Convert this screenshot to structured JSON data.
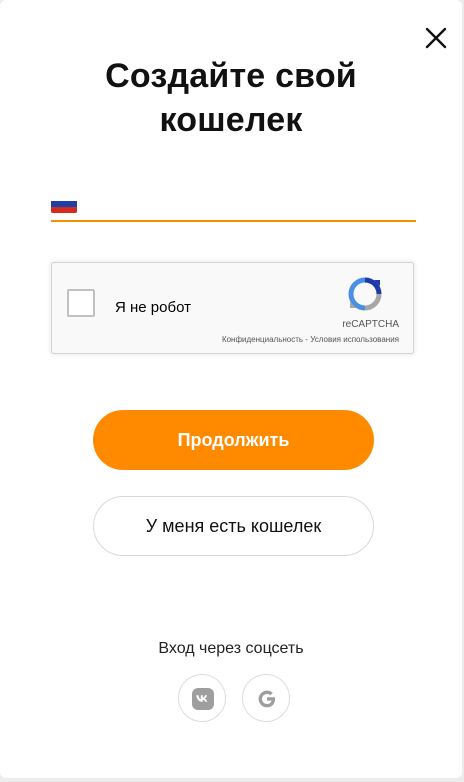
{
  "modal": {
    "title_line1": "Создайте свой",
    "title_line2": "кошелек"
  },
  "phone": {
    "country_flag": "russia-flag",
    "placeholder": ""
  },
  "captcha": {
    "label": "Я не робот",
    "brand": "reCAPTCHA",
    "links": "Конфиденциальность - Условия использования"
  },
  "actions": {
    "continue_label": "Продолжить",
    "have_wallet_label": "У меня есть кошелек"
  },
  "social": {
    "title": "Вход через соцсеть",
    "providers": [
      "vk-icon",
      "google-icon"
    ]
  },
  "colors": {
    "accent": "#ff8a00",
    "underline": "#f39200",
    "social_icon": "#9e9e9e"
  }
}
